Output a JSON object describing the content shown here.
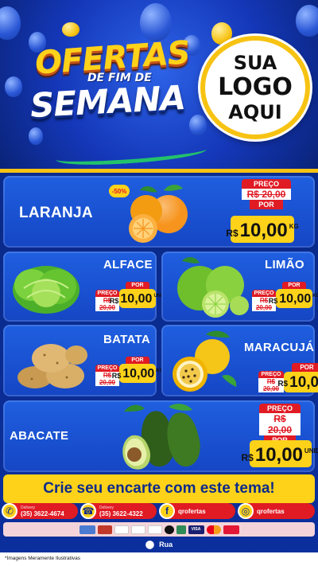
{
  "header": {
    "title_top": "OFERTAS",
    "title_mid": "DE FIM DE",
    "title_bottom": "SEMANA",
    "logo_line1": "SUA",
    "logo_line2": "LOGO",
    "logo_line3": "AQUI"
  },
  "products": {
    "laranja": {
      "name": "LARANJA",
      "badge": "-50%",
      "preco_label": "PREÇO",
      "old": "R$ 20,00",
      "por_label": "POR",
      "currency": "R$",
      "price": "10,00",
      "unit": "KG"
    },
    "alface": {
      "name": "ALFACE",
      "preco_label": "PREÇO",
      "old": "R$ 20,00",
      "por_label": "POR",
      "currency": "R$",
      "price": "10,00",
      "unit": "UNID"
    },
    "limao": {
      "name": "LIMÃO",
      "preco_label": "PREÇO",
      "old": "R$ 20,00",
      "por_label": "POR",
      "currency": "R$",
      "price": "10,00",
      "unit": "KG"
    },
    "batata": {
      "name": "BATATA",
      "preco_label": "PREÇO",
      "old": "R$ 20,00",
      "por_label": "POR",
      "currency": "R$",
      "price": "10,00",
      "unit": "KG"
    },
    "maracuja": {
      "name": "MARACUJÁ",
      "preco_label": "PREÇO",
      "old": "R$ 20,00",
      "por_label": "POR",
      "currency": "R$",
      "price": "10,00",
      "unit": "KG"
    },
    "abacate": {
      "name": "ABACATE",
      "preco_label": "PREÇO",
      "old": "R$ 20,00",
      "por_label": "POR",
      "currency": "R$",
      "price": "10,00",
      "unit": "UNID"
    }
  },
  "banner": "Crie seu encarte com este tema!",
  "contacts": {
    "delivery1": {
      "small": "Delivery",
      "value": "(35) 3622-4674"
    },
    "delivery2": {
      "small": "Delivery",
      "value": "(35) 3622-4322"
    },
    "facebook": {
      "value": "qrofertas"
    },
    "instagram": {
      "value": "qrofertas"
    }
  },
  "payments": [
    "",
    "",
    "",
    "",
    "",
    "",
    "",
    "VISA",
    "",
    ""
  ],
  "address": "Rua",
  "footnote": "*Imagens Meramente Ilustrativas",
  "colors": {
    "blue": "#1546c4",
    "yellow": "#ffd21a",
    "red": "#e01b24"
  }
}
